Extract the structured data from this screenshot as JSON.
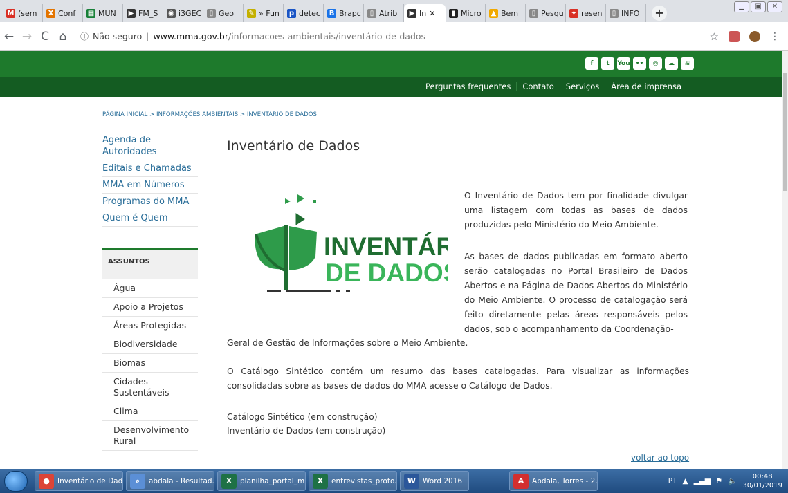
{
  "browser": {
    "tabs": [
      {
        "label": "(sem",
        "icon": "gmail-icon",
        "color": "#d93025",
        "glyph": "M"
      },
      {
        "label": "Conf",
        "icon": "x-icon",
        "color": "#e37400",
        "glyph": "X"
      },
      {
        "label": "MUN",
        "icon": "sheets-icon",
        "color": "#188038",
        "glyph": "▦"
      },
      {
        "label": "FM_S",
        "icon": "play-icon",
        "color": "#333333",
        "glyph": "▶"
      },
      {
        "label": "i3GEC",
        "icon": "eye-icon",
        "color": "#555555",
        "glyph": "◉"
      },
      {
        "label": "Geo",
        "icon": "page-icon",
        "color": "#888888",
        "glyph": "▯"
      },
      {
        "label": "» Fun",
        "icon": "pen-icon",
        "color": "#c4b000",
        "glyph": "✎"
      },
      {
        "label": "detec",
        "icon": "pl-icon",
        "color": "#1a55c5",
        "glyph": "p"
      },
      {
        "label": "Brapc",
        "icon": "b-icon",
        "color": "#1a73e8",
        "glyph": "B"
      },
      {
        "label": "Atrib",
        "icon": "page-icon",
        "color": "#888888",
        "glyph": "▯"
      },
      {
        "label": "In",
        "icon": "play-icon",
        "color": "#333333",
        "glyph": "▶"
      },
      {
        "label": "Micro",
        "icon": "chart-icon",
        "color": "#222222",
        "glyph": "▮"
      },
      {
        "label": "Bem",
        "icon": "flag-icon",
        "color": "#f1a900",
        "glyph": "▲"
      },
      {
        "label": "Pesqu",
        "icon": "page-icon",
        "color": "#888888",
        "glyph": "▯"
      },
      {
        "label": "resen",
        "icon": "pin-icon",
        "color": "#d93025",
        "glyph": "✦"
      },
      {
        "label": "INFO",
        "icon": "page-icon",
        "color": "#888888",
        "glyph": "▯"
      }
    ],
    "active_tab_index": 10,
    "new_tab": "+",
    "security": "Não seguro",
    "url_host": "www.mma.gov.br",
    "url_path": "/informacoes-ambientais/inventário-de-dados"
  },
  "site": {
    "social": [
      "f",
      "t",
      "You",
      "••",
      "◎",
      "☁",
      "≋"
    ],
    "nav": [
      "Perguntas frequentes",
      "Contato",
      "Serviços",
      "Área de imprensa"
    ],
    "breadcrumb": "PÁGINA INICIAL > INFORMAÇÕES AMBIENTAIS > INVENTÁRIO DE DADOS",
    "sidebar_links": [
      "Agenda de Autoridades",
      "Editais e Chamadas",
      "MMA em Números",
      "Programas do MMA",
      "Quem é Quem"
    ],
    "assuntos_label": "ASSUNTOS",
    "assuntos": [
      "Água",
      "Apoio a Projetos",
      "Áreas Protegidas",
      "Biodiversidade",
      "Biomas",
      "Cidades Sustentáveis",
      "Clima",
      "Desenvolvimento Rural"
    ],
    "title": "Inventário de Dados",
    "logo_line1": "INVENTÁRIO",
    "logo_line2": "DE DADOS",
    "p1": "O Inventário de Dados tem por finalidade divulgar uma listagem com todas as bases de dados produzidas pelo Ministério do Meio Ambiente.",
    "p2": "As bases de dados publicadas em formato aberto serão catalogadas no Portal Brasileiro de Dados Abertos e na Página de Dados Abertos do Ministério do Meio Ambiente. O processo de catalogação será feito diretamente pelas áreas responsáveis pelos dados, sob o acompanhamento da Coordenação-",
    "p2b": "Geral de Gestão de Informações sobre o Meio Ambiente.",
    "p3": "O Catálogo Sintético contém um resumo das bases catalogadas. Para visualizar as informações consolidadas sobre as bases de dados do MMA acesse o Catálogo de Dados.",
    "link1": "Catálogo Sintético (em construção)",
    "link2": "Inventário de Dados (em construção)",
    "voltar": "voltar ao topo"
  },
  "taskbar": {
    "items": [
      {
        "label": "Inventário de Dad...",
        "icon": "chrome-icon",
        "color": "#db4437"
      },
      {
        "label": "abdala - Resultad...",
        "icon": "search-icon",
        "color": "#5b8fd6"
      },
      {
        "label": "planilha_portal_m...",
        "icon": "excel-icon",
        "color": "#1e7145"
      },
      {
        "label": "entrevistas_proto...",
        "icon": "excel-icon",
        "color": "#1e7145"
      },
      {
        "label": "Word 2016",
        "icon": "word-icon",
        "color": "#2b579a"
      },
      {
        "label": "Abdala, Torres - 2...",
        "icon": "pdf-icon",
        "color": "#d32f2f"
      }
    ],
    "lang": "PT",
    "time": "00:48",
    "date": "30/01/2019"
  }
}
